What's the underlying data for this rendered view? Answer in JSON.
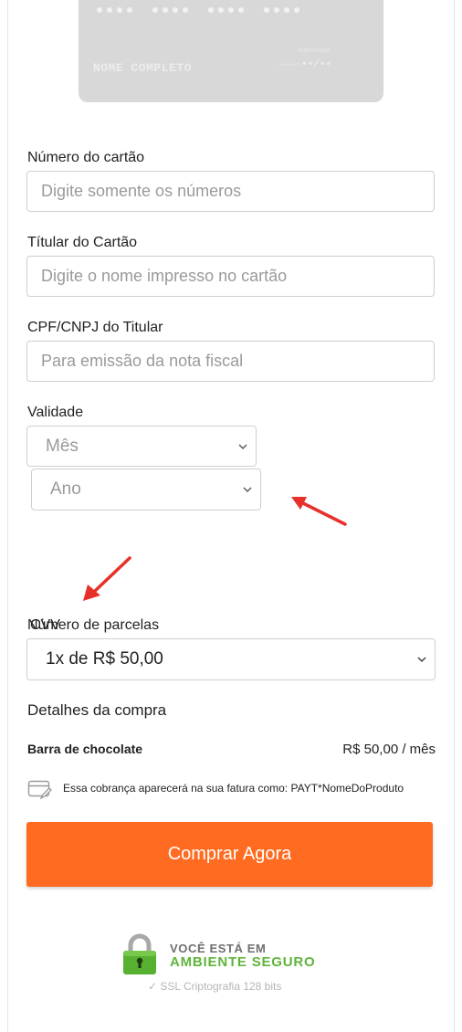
{
  "card_preview": {
    "holder_placeholder": "NOME COMPLETO",
    "validity_label": "VALIDO ATÉ",
    "validity_top_label": "MONTH/YEAR",
    "validity_value": "••/••"
  },
  "fields": {
    "card_number": {
      "label": "Número do cartão",
      "placeholder": "Digite somente os números"
    },
    "card_holder": {
      "label": "Títular do Cartão",
      "placeholder": "Digite o nome impresso no cartão"
    },
    "document": {
      "label": "CPF/CNPJ do Titular",
      "placeholder": "Para emissão da nota fiscal"
    },
    "validity": {
      "label": "Validade",
      "month_selected": "Mês",
      "year_selected": "Ano"
    },
    "cvv": {
      "label": "CVV"
    },
    "installments": {
      "label": "Número de parcelas",
      "selected": "1x de R$ 50,00"
    }
  },
  "details": {
    "title": "Detalhes da compra",
    "product_name": "Barra de chocolate",
    "product_price": "R$ 50,00 / mês",
    "billing_notice": "Essa cobrança aparecerá na sua fatura como: PAYT*NomeDoProduto"
  },
  "buy_button": {
    "label": "Comprar Agora"
  },
  "secure": {
    "line1": "VOCÊ ESTÁ EM",
    "line2": "AMBIENTE SEGURO",
    "ssl": "✓ SSL Criptografia 128 bits"
  },
  "colors": {
    "accent": "#ff6b21",
    "secure_green": "#5fb43a",
    "annotation_arrow": "#e8302a"
  }
}
